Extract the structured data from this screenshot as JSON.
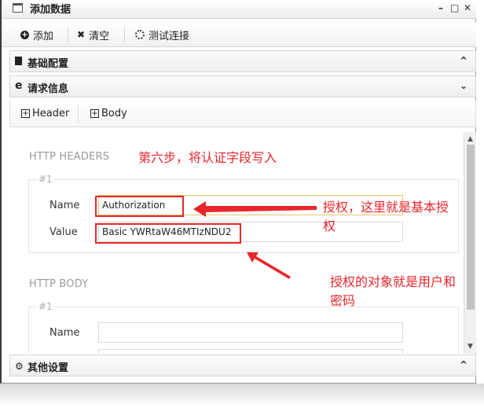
{
  "window": {
    "title": "添加数据",
    "min": "–",
    "max": "□",
    "close": "✕"
  },
  "toolbar": {
    "add_label": "添加",
    "clear_label": "清空",
    "test_label": "测试连接"
  },
  "sections": {
    "basic": "基础配置",
    "request": "请求信息",
    "other": "其他设置"
  },
  "tabs": {
    "header": "Header",
    "body": "Body"
  },
  "http_headers": {
    "title": "HTTP HEADERS",
    "item_index": "#1",
    "name_label": "Name",
    "name_value": "Authorization",
    "value_label": "Value",
    "value_value": "Basic YWRtaW46MTIzNDU2"
  },
  "http_body": {
    "title": "HTTP BODY",
    "item_index": "#1",
    "name_label": "Name",
    "name_value": ""
  },
  "annotations": {
    "step": "第六步，将认证字段写入",
    "auth_line1": "授权，这里就是基本授",
    "auth_line2": "权",
    "obj_line1": "授权的对象就是用户和",
    "obj_line2": "密码"
  },
  "colors": {
    "annotation_red": "#e8262b",
    "text_gray": "#9a9a9a"
  },
  "icons": {
    "add": "plus-circle-icon",
    "clear": "x-icon",
    "test": "spinner-icon"
  }
}
